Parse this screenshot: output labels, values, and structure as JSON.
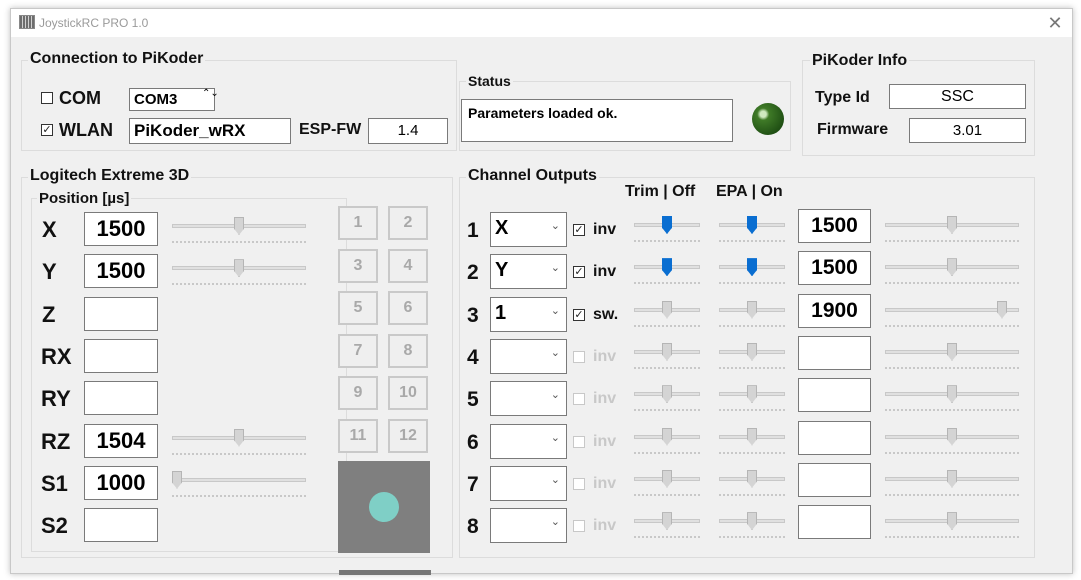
{
  "window": {
    "title": "JoystickRC PRO 1.0",
    "close_glyph": "✕"
  },
  "connection": {
    "title": "Connection to PiKoder",
    "com_label": "COM",
    "com_checked": false,
    "com_port": "COM3",
    "spin_glyph": "⌃⌄",
    "wlan_label": "WLAN",
    "wlan_checked": true,
    "wlan_ssid": "PiKoder_wRX",
    "espfw_label": "ESP-FW",
    "espfw_value": "1.4"
  },
  "status": {
    "title": "Status",
    "text": "Parameters loaded ok.",
    "led_color": "#3f7a27"
  },
  "info": {
    "title": "PiKoder Info",
    "typeid_label": "Type Id",
    "typeid_value": "SSC",
    "firmware_label": "Firmware",
    "firmware_value": "3.01"
  },
  "joystick": {
    "title": "Logitech Extreme 3D",
    "position_label": "Position [µs]",
    "axes": [
      {
        "label": "X",
        "value": "1500",
        "slider": true,
        "level": 0.5
      },
      {
        "label": "Y",
        "value": "1500",
        "slider": true,
        "level": 0.5
      },
      {
        "label": "Z",
        "value": "",
        "slider": false
      },
      {
        "label": "RX",
        "value": "",
        "slider": false
      },
      {
        "label": "RY",
        "value": "",
        "slider": false
      },
      {
        "label": "RZ",
        "value": "1504",
        "slider": true,
        "level": 0.5
      },
      {
        "label": "S1",
        "value": "1000",
        "slider": true,
        "level": 0.0
      },
      {
        "label": "S2",
        "value": "",
        "slider": false
      }
    ],
    "buttons": [
      "1",
      "2",
      "3",
      "4",
      "5",
      "6",
      "7",
      "8",
      "9",
      "10",
      "11",
      "12"
    ],
    "pad_color": "#7f7f7f",
    "dot_color": "#7fcfc6"
  },
  "channels": {
    "title": "Channel Outputs",
    "trim_header": "Trim | Off",
    "epa_header": "EPA | On",
    "dropdown_glyph": "⌄",
    "rows": [
      {
        "num": "1",
        "source": "X",
        "checked": true,
        "enabled": true,
        "opt": "inv",
        "trim_active": true,
        "trim_level": 0.5,
        "epa_active": true,
        "epa_level": 0.5,
        "value": "1500",
        "out_level": 0.5
      },
      {
        "num": "2",
        "source": "Y",
        "checked": true,
        "enabled": true,
        "opt": "inv",
        "trim_active": true,
        "trim_level": 0.5,
        "epa_active": true,
        "epa_level": 0.5,
        "value": "1500",
        "out_level": 0.5
      },
      {
        "num": "3",
        "source": "1",
        "checked": true,
        "enabled": true,
        "opt": "sw.",
        "trim_active": false,
        "trim_level": 0.5,
        "epa_active": false,
        "epa_level": 0.5,
        "value": "1900",
        "out_level": 0.9
      },
      {
        "num": "4",
        "source": "",
        "checked": false,
        "enabled": false,
        "opt": "inv",
        "trim_active": false,
        "trim_level": 0.5,
        "epa_active": false,
        "epa_level": 0.5,
        "value": "",
        "out_level": 0.5
      },
      {
        "num": "5",
        "source": "",
        "checked": false,
        "enabled": false,
        "opt": "inv",
        "trim_active": false,
        "trim_level": 0.5,
        "epa_active": false,
        "epa_level": 0.5,
        "value": "",
        "out_level": 0.5
      },
      {
        "num": "6",
        "source": "",
        "checked": false,
        "enabled": false,
        "opt": "inv",
        "trim_active": false,
        "trim_level": 0.5,
        "epa_active": false,
        "epa_level": 0.5,
        "value": "",
        "out_level": 0.5
      },
      {
        "num": "7",
        "source": "",
        "checked": false,
        "enabled": false,
        "opt": "inv",
        "trim_active": false,
        "trim_level": 0.5,
        "epa_active": false,
        "epa_level": 0.5,
        "value": "",
        "out_level": 0.5
      },
      {
        "num": "8",
        "source": "",
        "checked": false,
        "enabled": false,
        "opt": "inv",
        "trim_active": false,
        "trim_level": 0.5,
        "epa_active": false,
        "epa_level": 0.5,
        "value": "",
        "out_level": 0.5
      }
    ]
  }
}
